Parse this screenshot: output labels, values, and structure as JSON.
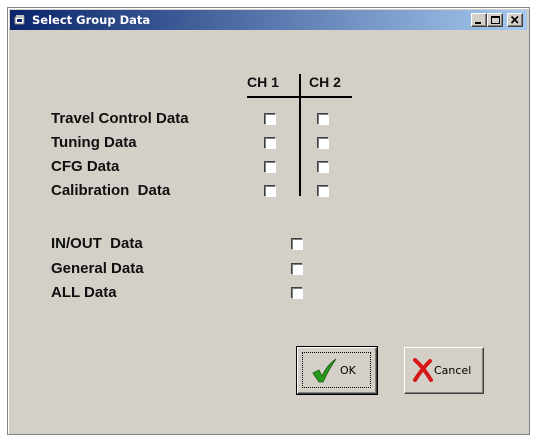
{
  "window": {
    "title": "Select Group Data"
  },
  "columns": {
    "ch1": "CH 1",
    "ch2": "CH 2"
  },
  "channel_rows": [
    {
      "label": "Travel Control Data",
      "ch1_checked": false,
      "ch2_checked": false
    },
    {
      "label": "Tuning Data",
      "ch1_checked": false,
      "ch2_checked": false
    },
    {
      "label": "CFG Data",
      "ch1_checked": false,
      "ch2_checked": false
    },
    {
      "label": "Calibration  Data",
      "ch1_checked": false,
      "ch2_checked": false
    }
  ],
  "general_rows": [
    {
      "label": "IN/OUT  Data",
      "checked": false
    },
    {
      "label": "General Data",
      "checked": false
    },
    {
      "label": "ALL Data",
      "checked": false
    }
  ],
  "buttons": {
    "ok_label": "OK",
    "cancel_label": "Cancel"
  },
  "icons": {
    "ok": "checkmark-icon",
    "cancel": "red-x-icon",
    "title": "app-icon"
  },
  "colors": {
    "titlebar_start": "#0a246a",
    "titlebar_end": "#a6caf0",
    "dialog_bg": "#d4d0c8",
    "ok_check": "#2a9a1a",
    "cancel_x": "#d81818"
  }
}
